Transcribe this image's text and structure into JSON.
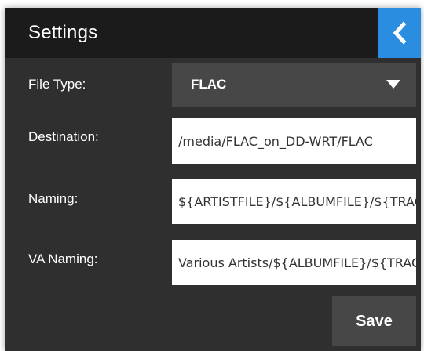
{
  "header": {
    "title": "Settings",
    "back_icon": "chevron-left-icon",
    "accent_color": "#2a8de0"
  },
  "form": {
    "file_type": {
      "label": "File Type:",
      "value": "FLAC"
    },
    "destination": {
      "label": "Destination:",
      "value": "/media/FLAC_on_DD-WRT/FLAC"
    },
    "naming": {
      "label": "Naming:",
      "value": "${ARTISTFILE}/${ALBUMFILE}/${TRACKFILE}"
    },
    "va_naming": {
      "label": "VA Naming:",
      "value": "Various Artists/${ALBUMFILE}/${TRACKFILE}"
    }
  },
  "actions": {
    "save_label": "Save"
  }
}
